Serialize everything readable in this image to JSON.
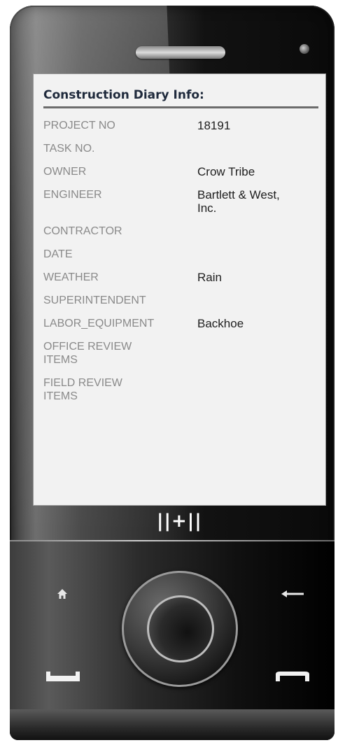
{
  "screen": {
    "title": "Construction Diary Info:",
    "fields": [
      {
        "label": "PROJECT NO",
        "value": "18191"
      },
      {
        "label": "TASK NO.",
        "value": ""
      },
      {
        "label": "OWNER",
        "value": "Crow Tribe"
      },
      {
        "label": "ENGINEER",
        "value": "Bartlett & West, Inc."
      },
      {
        "label": "CONTRACTOR",
        "value": ""
      },
      {
        "label": "DATE",
        "value": ""
      },
      {
        "label": "WEATHER",
        "value": "Rain"
      },
      {
        "label": "SUPERINTENDENT",
        "value": ""
      },
      {
        "label": "LABOR_EQUIPMENT",
        "value": "Backhoe"
      },
      {
        "label": "OFFICE REVIEW ITEMS",
        "value": ""
      },
      {
        "label": "FIELD REVIEW ITEMS",
        "value": ""
      }
    ]
  },
  "device": {
    "logo_text": "||+||",
    "icons": {
      "home": "home-icon",
      "back": "back-arrow-icon",
      "call": "call-icon",
      "end": "end-call-icon"
    }
  },
  "colors": {
    "screen_bg": "#f2f2f2",
    "title_text": "#1f2a3c",
    "label_text": "#8a8a8a",
    "value_text": "#202020"
  }
}
